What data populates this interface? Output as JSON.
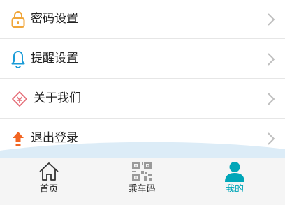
{
  "menu": {
    "items": [
      {
        "label": "密码设置",
        "icon": "lock-icon"
      },
      {
        "label": "提醒设置",
        "icon": "bell-icon"
      },
      {
        "label": "关于我们",
        "icon": "info-diamond-icon"
      },
      {
        "label": "退出登录",
        "icon": "logout-arrow-icon"
      }
    ]
  },
  "tabbar": {
    "tabs": [
      {
        "label": "首页",
        "icon": "home-icon",
        "active": false
      },
      {
        "label": "乘车码",
        "icon": "qr-code-icon",
        "active": false
      },
      {
        "label": "我的",
        "icon": "user-icon",
        "active": true
      }
    ]
  },
  "colors": {
    "accent": "#00a6b8",
    "lock": "#f0a63a",
    "bell": "#1a9bd7",
    "info": "#e5707a",
    "logout": "#f26522",
    "wave": "#dcecf7"
  }
}
